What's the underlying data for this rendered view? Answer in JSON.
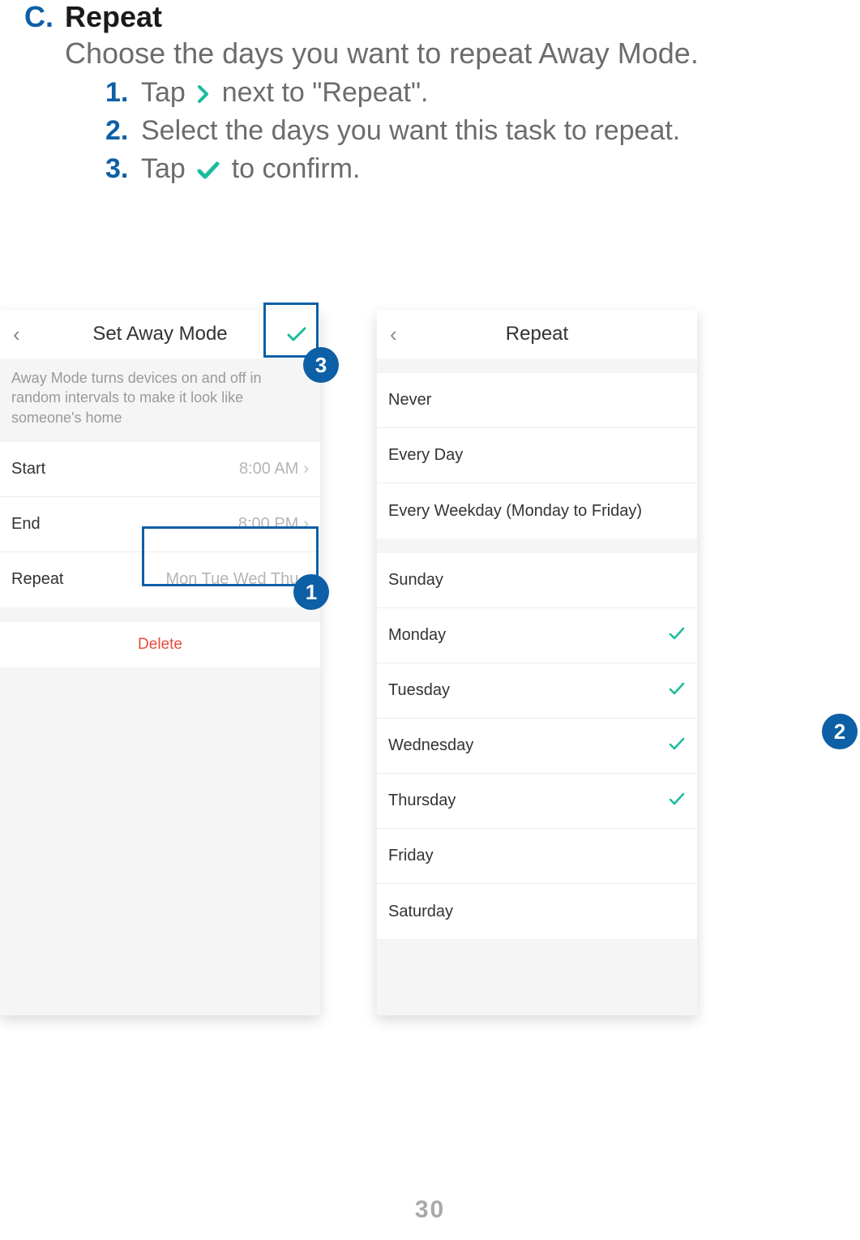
{
  "section": {
    "letter": "C.",
    "title": "Repeat",
    "desc": "Choose the days you want to repeat Away Mode."
  },
  "steps": {
    "s1": {
      "num": "1.",
      "a": "Tap",
      "b": "next to \"Repeat\"."
    },
    "s2": {
      "num": "2.",
      "text": "Select the days you want this task to repeat."
    },
    "s3": {
      "num": "3.",
      "a": "Tap",
      "b": "to confirm."
    }
  },
  "screen1": {
    "title": "Set Away Mode",
    "desc": "Away Mode turns devices on and off in random intervals to make it look like someone's home",
    "start_label": "Start",
    "start_value": "8:00 AM",
    "end_label": "End",
    "end_value": "8:00 PM",
    "repeat_label": "Repeat",
    "repeat_value": "Mon Tue Wed Thu",
    "delete": "Delete"
  },
  "screen2": {
    "title": "Repeat",
    "presets": {
      "never": "Never",
      "every_day": "Every Day",
      "weekdays": "Every Weekday (Monday to Friday)"
    },
    "days": {
      "sun": {
        "label": "Sunday",
        "checked": false
      },
      "mon": {
        "label": "Monday",
        "checked": true
      },
      "tue": {
        "label": "Tuesday",
        "checked": true
      },
      "wed": {
        "label": "Wednesday",
        "checked": true
      },
      "thu": {
        "label": "Thursday",
        "checked": true
      },
      "fri": {
        "label": "Friday",
        "checked": false
      },
      "sat": {
        "label": "Saturday",
        "checked": false
      }
    }
  },
  "badges": {
    "b1": "1",
    "b2": "2",
    "b3": "3"
  },
  "page_number": "30"
}
